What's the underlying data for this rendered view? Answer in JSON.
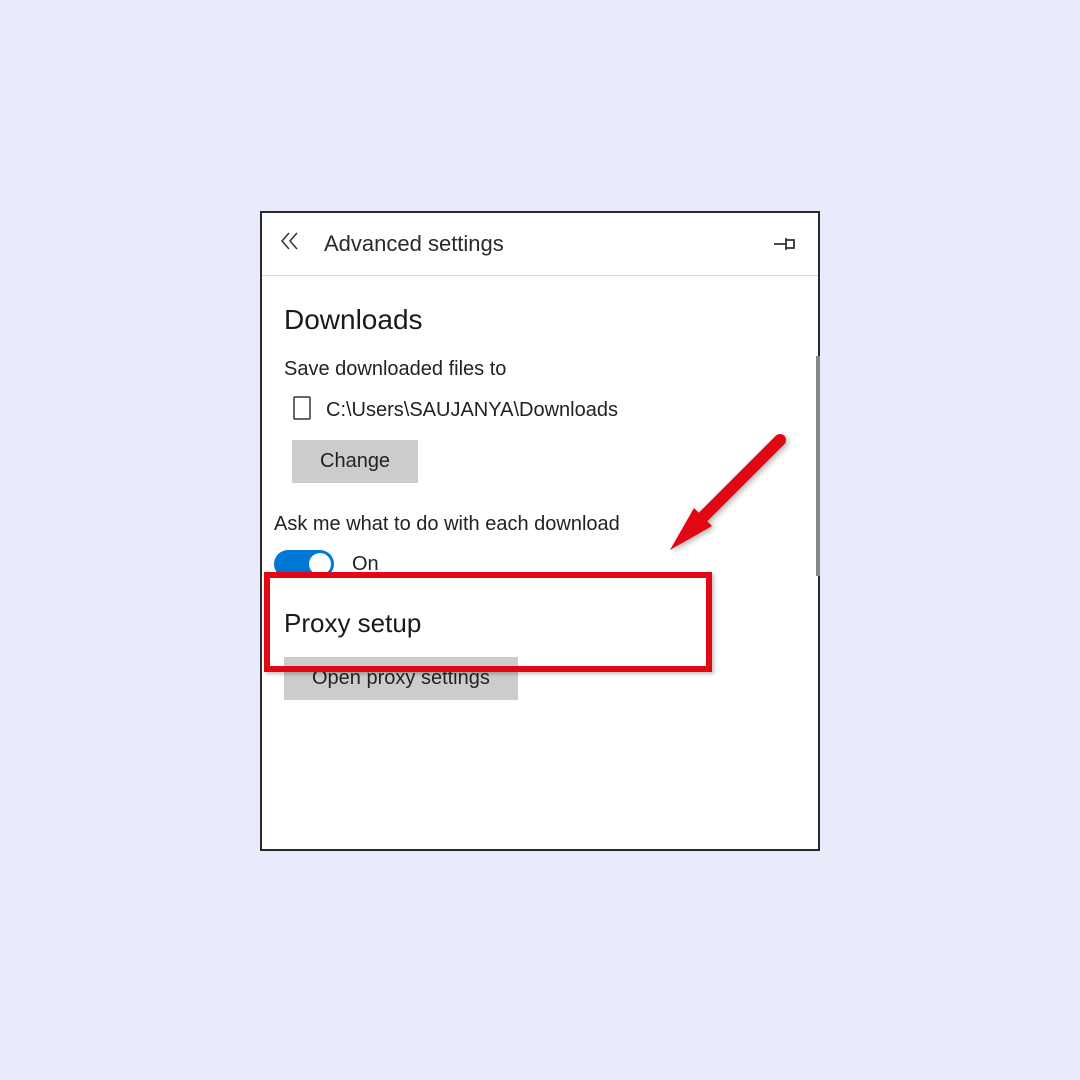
{
  "header": {
    "title": "Advanced settings"
  },
  "downloads": {
    "heading": "Downloads",
    "save_label": "Save downloaded files to",
    "path": "C:\\Users\\SAUJANYA\\Downloads",
    "change_label": "Change",
    "ask_label": "Ask me what to do with each download",
    "toggle_state": "On"
  },
  "proxy": {
    "heading": "Proxy setup",
    "open_label": "Open proxy settings"
  }
}
